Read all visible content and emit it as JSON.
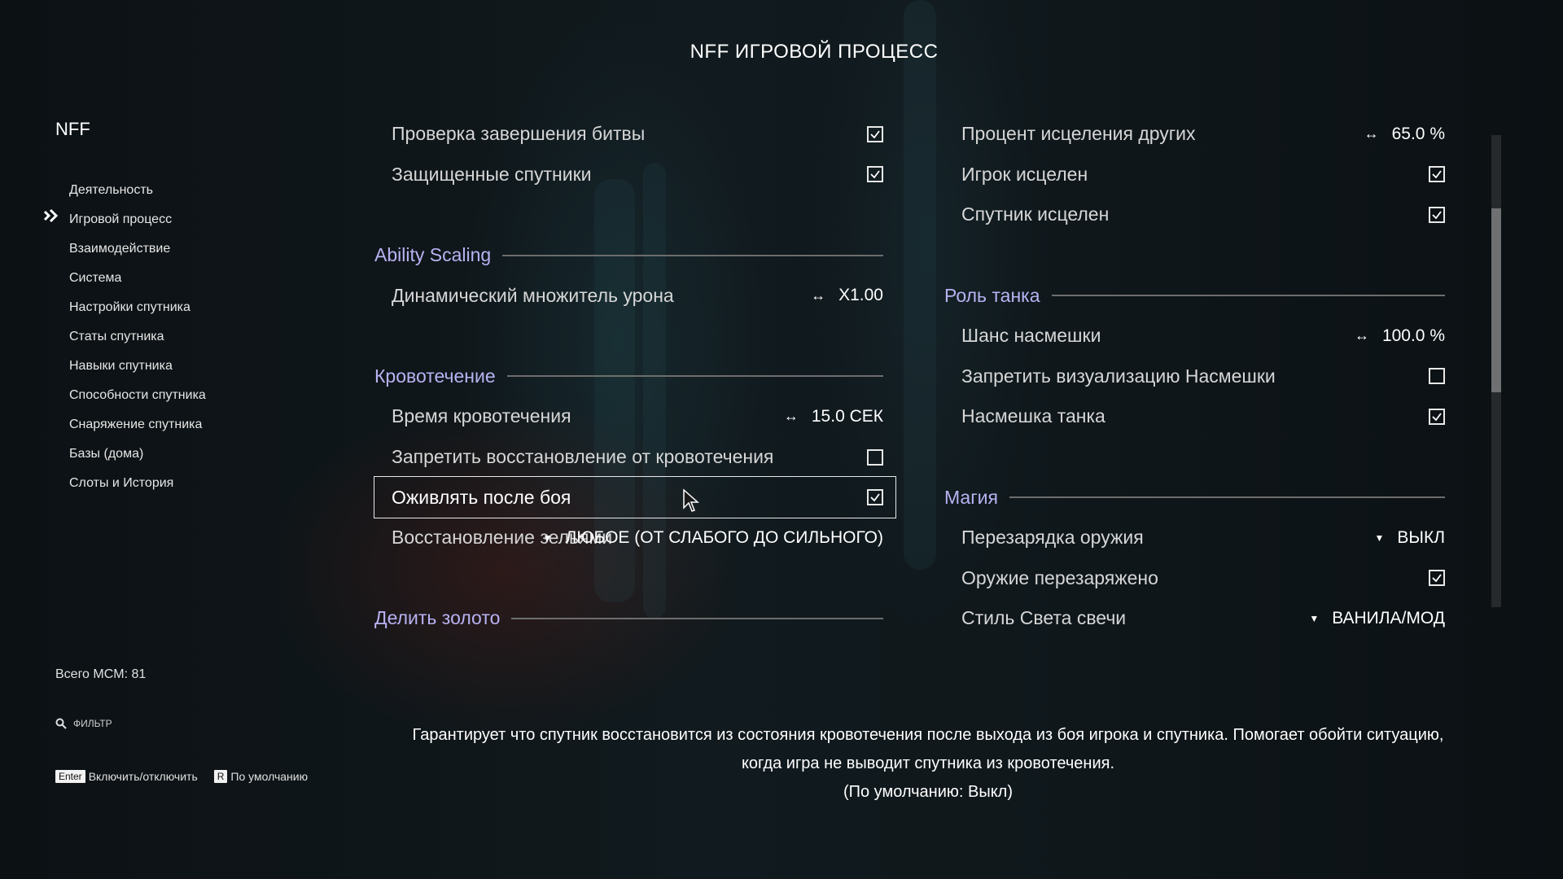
{
  "page_title": "NFF ИГРОВОЙ ПРОЦЕСС",
  "sidebar": {
    "title": "NFF",
    "items": [
      {
        "label": "Деятельность",
        "active": false
      },
      {
        "label": "Игровой процесс",
        "active": true
      },
      {
        "label": "Взаимодействие",
        "active": false
      },
      {
        "label": "Система",
        "active": false
      },
      {
        "label": "Настройки спутника",
        "active": false
      },
      {
        "label": "Статы спутника",
        "active": false
      },
      {
        "label": "Навыки спутника",
        "active": false
      },
      {
        "label": "Способности спутника",
        "active": false
      },
      {
        "label": "Снаряжение спутника",
        "active": false
      },
      {
        "label": "Базы (дома)",
        "active": false
      },
      {
        "label": "Слоты и История",
        "active": false
      }
    ],
    "total_mcm": "Всего MCM: 81",
    "filter_placeholder": "ФИЛЬТР",
    "hints": [
      {
        "key": "Enter",
        "label": "Включить/отключить"
      },
      {
        "key": "R",
        "label": "По умолчанию"
      }
    ]
  },
  "left_column": {
    "row_battle_check": {
      "label": "Проверка завершения битвы",
      "checked": true
    },
    "row_protected": {
      "label": "Защищенные спутники",
      "checked": true
    },
    "header_ability": "Ability Scaling",
    "row_damage_mult": {
      "label": "Динамический множитель урона",
      "value": "X1.00"
    },
    "header_bleed": "Кровотечение",
    "row_bleed_time": {
      "label": "Время кровотечения",
      "value": "15.0 СЕК"
    },
    "row_forbid_recovery": {
      "label": "Запретить восстановление от кровотечения",
      "checked": false
    },
    "row_revive": {
      "label": "Оживлять после боя",
      "checked": true
    },
    "row_potion": {
      "label": "Восстановление зельями",
      "value": "ЛЮБОЕ (ОТ СЛАБОГО ДО СИЛЬНОГО)"
    },
    "header_gold": "Делить золото"
  },
  "right_column": {
    "row_heal_percent": {
      "label": "Процент исцеления других",
      "value": "65.0 %"
    },
    "row_player_healed": {
      "label": "Игрок исцелен",
      "checked": true
    },
    "row_follower_healed": {
      "label": "Спутник исцелен",
      "checked": true
    },
    "header_tank": "Роль танка",
    "row_taunt_chance": {
      "label": "Шанс насмешки",
      "value": "100.0 %"
    },
    "row_forbid_taunt_vis": {
      "label": "Запретить визуализацию Насмешки",
      "checked": false
    },
    "row_tank_taunt": {
      "label": "Насмешка танка",
      "checked": true
    },
    "header_magic": "Магия",
    "row_weapon_recharge": {
      "label": "Перезарядка оружия",
      "value": "ВЫКЛ"
    },
    "row_weapon_recharged": {
      "label": "Оружие перезаряжено",
      "checked": true
    },
    "row_candle_style": {
      "label": "Стиль Света свечи",
      "value": "ВАНИЛА/МОД"
    }
  },
  "description": {
    "line1": "Гарантирует что спутник восстановится из состояния кровотечения после выхода из боя игрока и спутника. Помогает обойти ситуацию,",
    "line2": "когда игра не выводит спутника из кровотечения.",
    "line3": "(По умолчанию: Выкл)"
  },
  "colors": {
    "header_accent": "#b8b2f2",
    "text": "#d6d6d6",
    "background": "#0f1418"
  }
}
